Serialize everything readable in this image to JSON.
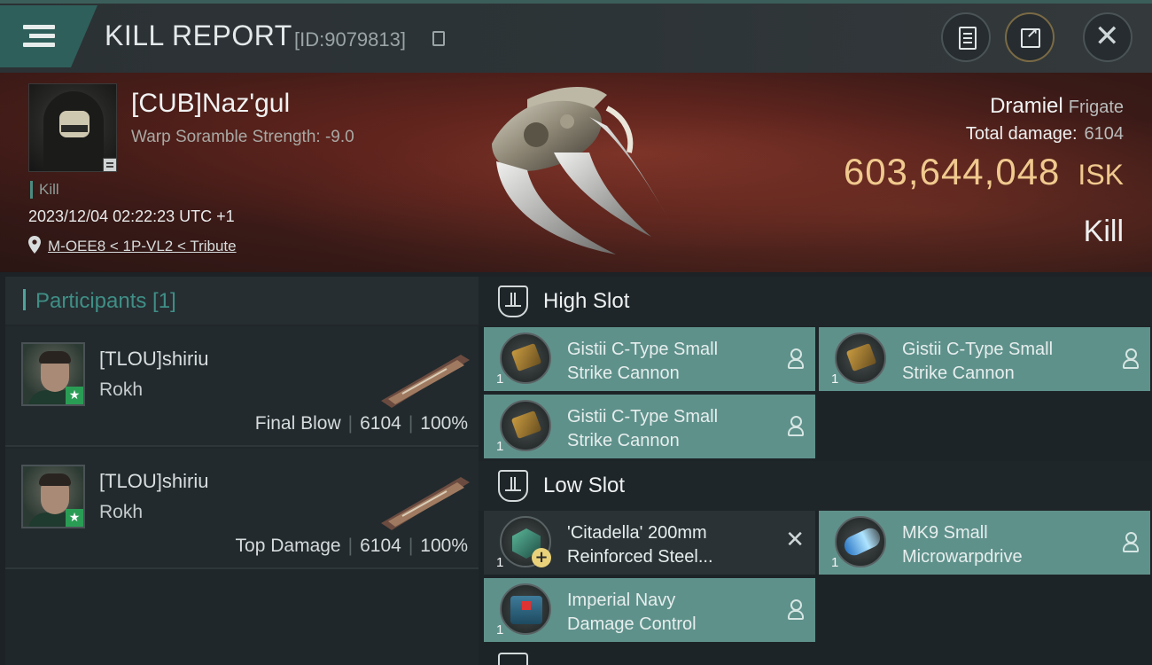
{
  "header": {
    "title": "KILL REPORT",
    "report_id": "[ID:9079813]"
  },
  "victim": {
    "name": "[CUB]Naz'gul",
    "stat": "Warp Soramble Strength: -9.0",
    "tag": "Kill",
    "datetime": "2023/12/04 02:22:23 UTC +1",
    "location": "M-OEE8 < 1P-VL2 < Tribute",
    "ship": "Dramiel",
    "ship_class": "Frigate",
    "total_damage_label": "Total damage:",
    "total_damage": "6104",
    "isk_value": "603,644,048",
    "isk_currency": "ISK",
    "result": "Kill"
  },
  "participants": {
    "title": "Participants [1]",
    "rows": [
      {
        "name": "[TLOU]shiriu",
        "ship": "Rokh",
        "role": "Final Blow",
        "damage": "6104",
        "percent": "100%"
      },
      {
        "name": "[TLOU]shiriu",
        "ship": "Rokh",
        "role": "Top Damage",
        "damage": "6104",
        "percent": "100%"
      }
    ]
  },
  "slots": {
    "high": {
      "label": "High Slot",
      "items": [
        {
          "line1": "Gistii C-Type Small",
          "line2": "Strike Cannon",
          "qty": "1"
        },
        {
          "line1": "Gistii C-Type Small",
          "line2": "Strike Cannon",
          "qty": "1"
        },
        {
          "line1": "Gistii C-Type Small",
          "line2": "Strike Cannon",
          "qty": "1"
        }
      ]
    },
    "low": {
      "label": "Low Slot",
      "items": [
        {
          "line1": "'Citadella' 200mm",
          "line2": "Reinforced Steel...",
          "qty": "1"
        },
        {
          "line1": "MK9 Small",
          "line2": "Microwarpdrive",
          "qty": "1"
        },
        {
          "line1": "Imperial Navy",
          "line2": "Damage Control",
          "qty": "1"
        }
      ]
    }
  },
  "colors": {
    "accent_teal": "#5f918b",
    "isk_gold": "#f0c98e",
    "header_tab": "#2f5f5a"
  }
}
